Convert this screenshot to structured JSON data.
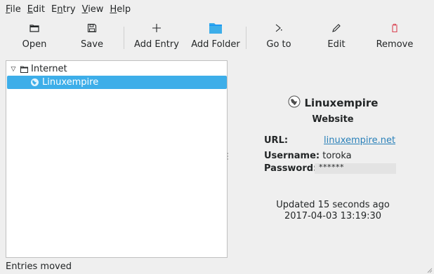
{
  "menubar": {
    "items": [
      {
        "mnemonic": "F",
        "rest": "ile"
      },
      {
        "mnemonic": "E",
        "rest": "dit"
      },
      {
        "pre": "E",
        "mnemonic": "n",
        "rest": "try"
      },
      {
        "mnemonic": "V",
        "rest": "iew"
      },
      {
        "mnemonic": "H",
        "rest": "elp"
      }
    ]
  },
  "toolbar": {
    "open": "Open",
    "save": "Save",
    "add_entry": "Add Entry",
    "add_folder": "Add Folder",
    "go_to": "Go to",
    "edit": "Edit",
    "remove": "Remove"
  },
  "tree": {
    "group_label": "Internet",
    "entry_label": "Linuxempire",
    "expander": "▽"
  },
  "details": {
    "title": "Linuxempire",
    "type": "Website",
    "url_label": "URL:",
    "url_value": "linuxempire.net",
    "username_label": "Username:",
    "username_value": "toroka",
    "password_label": "Password:",
    "password_value": "******",
    "updated_line1": "Updated 15 seconds ago",
    "updated_line2": "2017-04-03 13:19:30"
  },
  "status": {
    "text": "Entries moved"
  },
  "colors": {
    "selection": "#3daee9",
    "link": "#2980b9",
    "remove_icon": "#da4453",
    "folder_icon": "#3daee9"
  }
}
